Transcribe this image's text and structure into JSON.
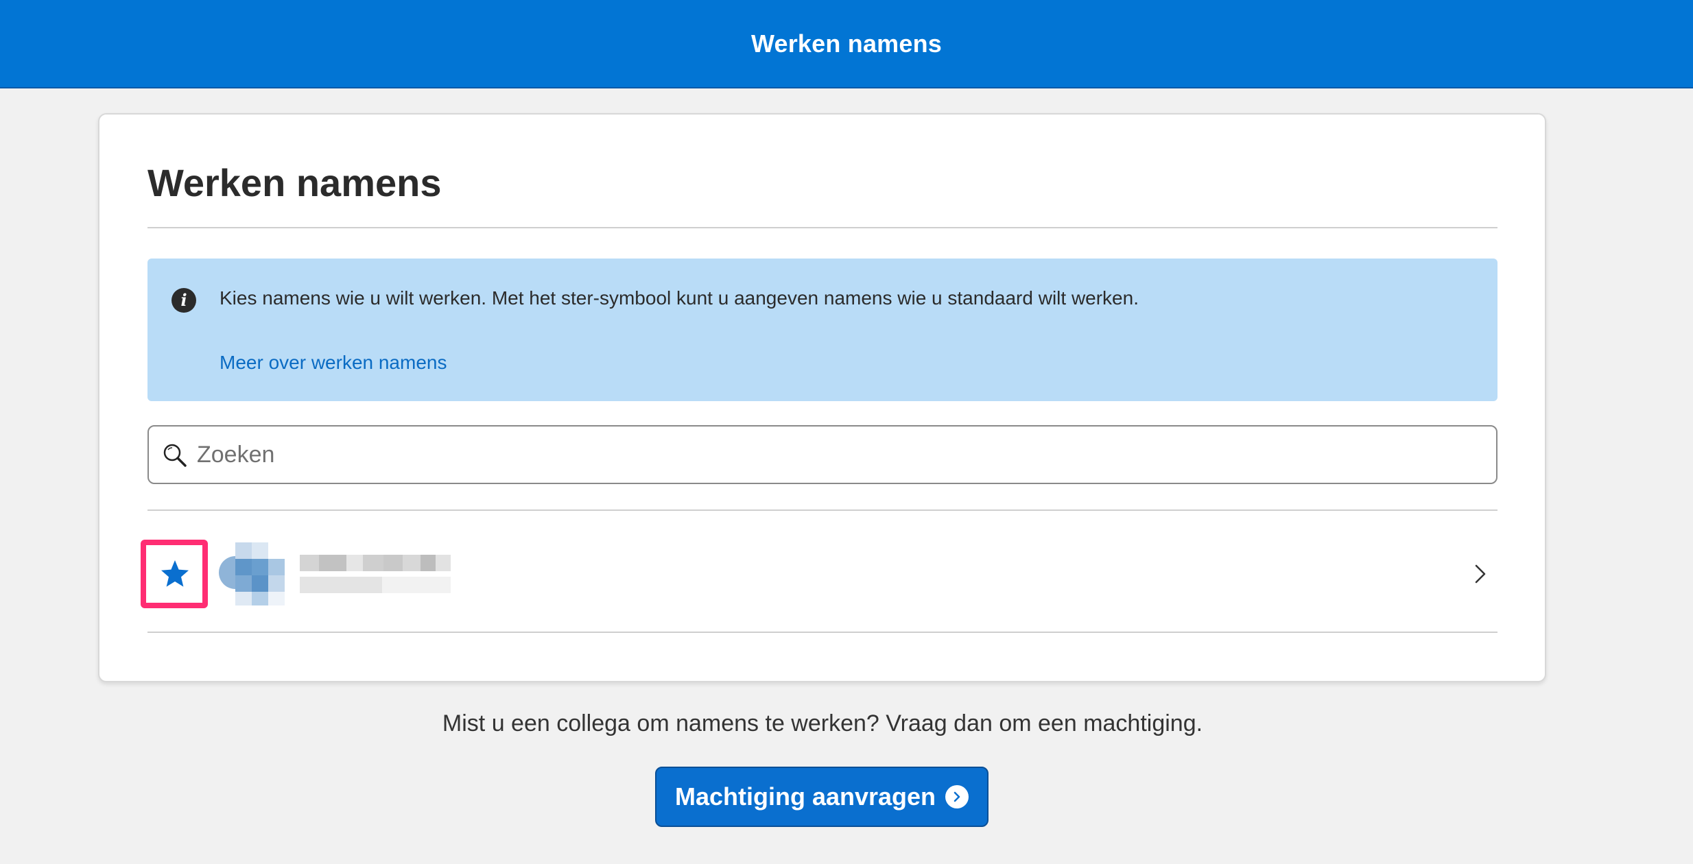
{
  "header": {
    "title": "Werken namens"
  },
  "card": {
    "title": "Werken namens",
    "info": {
      "icon": "info-icon",
      "text": "Kies namens wie u wilt werken. Met het ster-symbool kunt u aangeven namens wie u standaard wilt werken.",
      "link": "Meer over werken namens"
    },
    "search": {
      "placeholder": "Zoeken",
      "value": "",
      "icon": "search-icon"
    },
    "list": [
      {
        "starred": true,
        "star_icon": "star-icon",
        "avatar": "avatar",
        "name": "",
        "detail": "",
        "chevron_icon": "chevron-right-icon"
      }
    ]
  },
  "footer": {
    "text": "Mist u een collega om namens te werken? Vraag dan om een machtiging.",
    "button_label": "Machtiging aanvragen",
    "button_icon": "arrow-circle-right-icon"
  },
  "colors": {
    "brand": "#0275d4",
    "info_background": "#b9dcf7",
    "link": "#0a6bc3",
    "highlight": "#ff2d73",
    "star": "#0a6fcf"
  }
}
